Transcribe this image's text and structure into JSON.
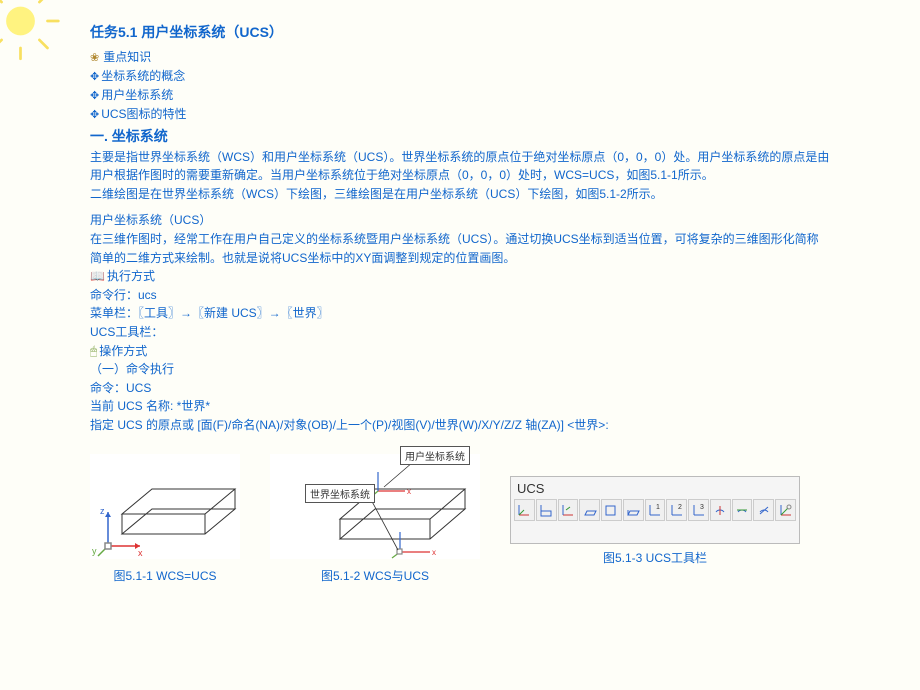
{
  "title": "任务5.1  用户坐标系统（UCS）",
  "bullets": {
    "main": "重点知识",
    "items": [
      "坐标系统的概念",
      "用户坐标系统",
      "UCS图标的特性"
    ]
  },
  "section1": {
    "heading": "一. 坐标系统",
    "p1": "主要是指世界坐标系统（WCS）和用户坐标系统（UCS）。世界坐标系统的原点位于绝对坐标原点（0，0，0）处。用户坐标系统的原点是由用户根据作图时的需要重新确定。当用户坐标系统位于绝对坐标原点（0，0，0）处时，WCS=UCS，如图5.1-1所示。",
    "p2": "二维绘图是在世界坐标系统（WCS）下绘图，三维绘图是在用户坐标系统（UCS）下绘图，如图5.1-2所示。"
  },
  "ucs_section": {
    "heading": "用户坐标系统（UCS）",
    "desc": "在三维作图时，经常工作在用户自己定义的坐标系统暨用户坐标系统（UCS）。通过切换UCS坐标到适当位置，可将复杂的三维图形化简称简单的二维方式来绘制。也就是说将UCS坐标中的XY面调整到规定的位置画图。",
    "exec_label": "执行方式",
    "cmd_line": "命令行：ucs",
    "menu_line": "菜单栏：〖工具〗→〖新建 UCS〗→〖世界〗",
    "toolbar_line": "UCS工具栏：",
    "op_label": "操作方式",
    "op1": "（一）命令执行",
    "op2": "命令：UCS",
    "op3": "当前 UCS 名称: *世界*",
    "op4": "指定 UCS 的原点或 [面(F)/命名(NA)/对象(OB)/上一个(P)/视图(V)/世界(W)/X/Y/Z/Z 轴(ZA)] <世界>:"
  },
  "figures": {
    "fig1_caption": "图5.1-1  WCS=UCS",
    "fig2_caption": "图5.1-2   WCS与UCS",
    "fig3_caption": "图5.1-3  UCS工具栏",
    "callout_user": "用户坐标系统",
    "callout_world": "世界坐标系统",
    "toolbar_title": "UCS"
  }
}
